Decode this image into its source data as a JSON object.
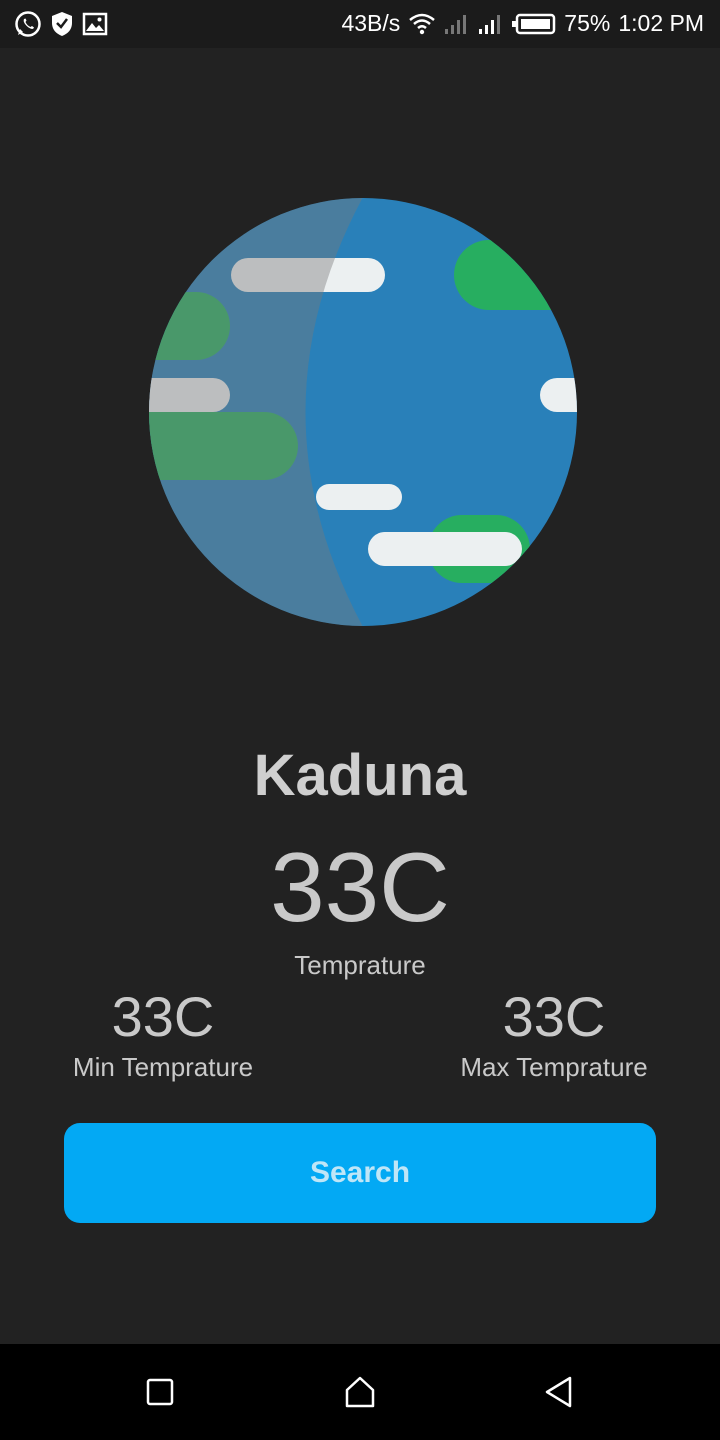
{
  "status_bar": {
    "left_icons": [
      "whatsapp-icon",
      "shield-icon",
      "image-icon"
    ],
    "network_speed": "43B/s",
    "battery_percent": "75%",
    "time": "1:02 PM"
  },
  "weather": {
    "city": "Kaduna",
    "temperature": "33C",
    "temperature_label": "Temprature",
    "min_temperature": "33C",
    "min_label": "Min Temprature",
    "max_temperature": "33C",
    "max_label": "Max Temprature"
  },
  "search": {
    "label": "Search"
  },
  "colors": {
    "background": "#222222",
    "accent": "#03a9f4",
    "globe_ocean": "#2980b9",
    "globe_land": "#27ae60",
    "cloud": "#ecf0f1"
  },
  "nav": {
    "icons": [
      "recents-icon",
      "home-icon",
      "back-icon"
    ]
  }
}
